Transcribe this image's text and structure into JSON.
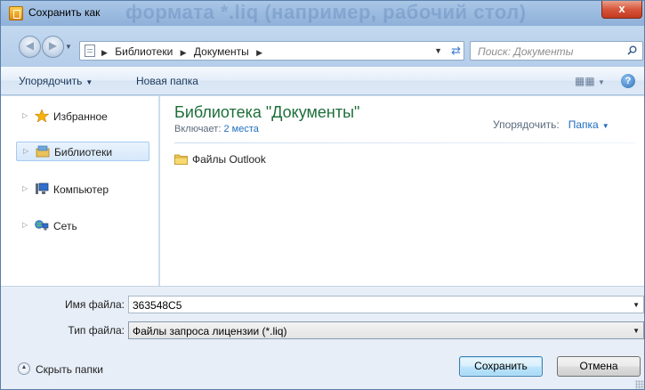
{
  "window": {
    "title": "Сохранить как",
    "background_text": "формата *.liq (например, рабочий стол)",
    "close_label": "x"
  },
  "address_bar": {
    "back_icon": "back-arrow-icon",
    "forward_icon": "forward-arrow-icon",
    "crumbs": [
      "Библиотеки",
      "Документы"
    ],
    "search_placeholder": "Поиск: Документы"
  },
  "toolbar": {
    "organize_label": "Упорядочить",
    "new_folder_label": "Новая папка",
    "help_label": "?"
  },
  "nav": {
    "items": [
      {
        "label": "Избранное",
        "icon": "star-icon"
      },
      {
        "label": "Библиотеки",
        "icon": "library-icon",
        "selected": true
      },
      {
        "label": "Компьютер",
        "icon": "computer-icon"
      },
      {
        "label": "Сеть",
        "icon": "network-icon"
      }
    ]
  },
  "content": {
    "library_title": "Библиотека \"Документы\"",
    "includes_label": "Включает:",
    "includes_value": "2 места",
    "arrange_label": "Упорядочить:",
    "arrange_value": "Папка",
    "items": [
      {
        "name": "Файлы Outlook",
        "icon": "folder-icon"
      }
    ]
  },
  "form": {
    "filename_label": "Имя файла:",
    "filename_value": "363548C5",
    "filetype_label": "Тип файла:",
    "filetype_value": "Файлы запроса лицензии (*.liq)",
    "hide_folders_label": "Скрыть папки",
    "save_label": "Сохранить",
    "cancel_label": "Отмена"
  },
  "colors": {
    "accent_green": "#1e6e3a",
    "link_blue": "#1e6fbf",
    "frame_blue": "#c7dcf0"
  }
}
